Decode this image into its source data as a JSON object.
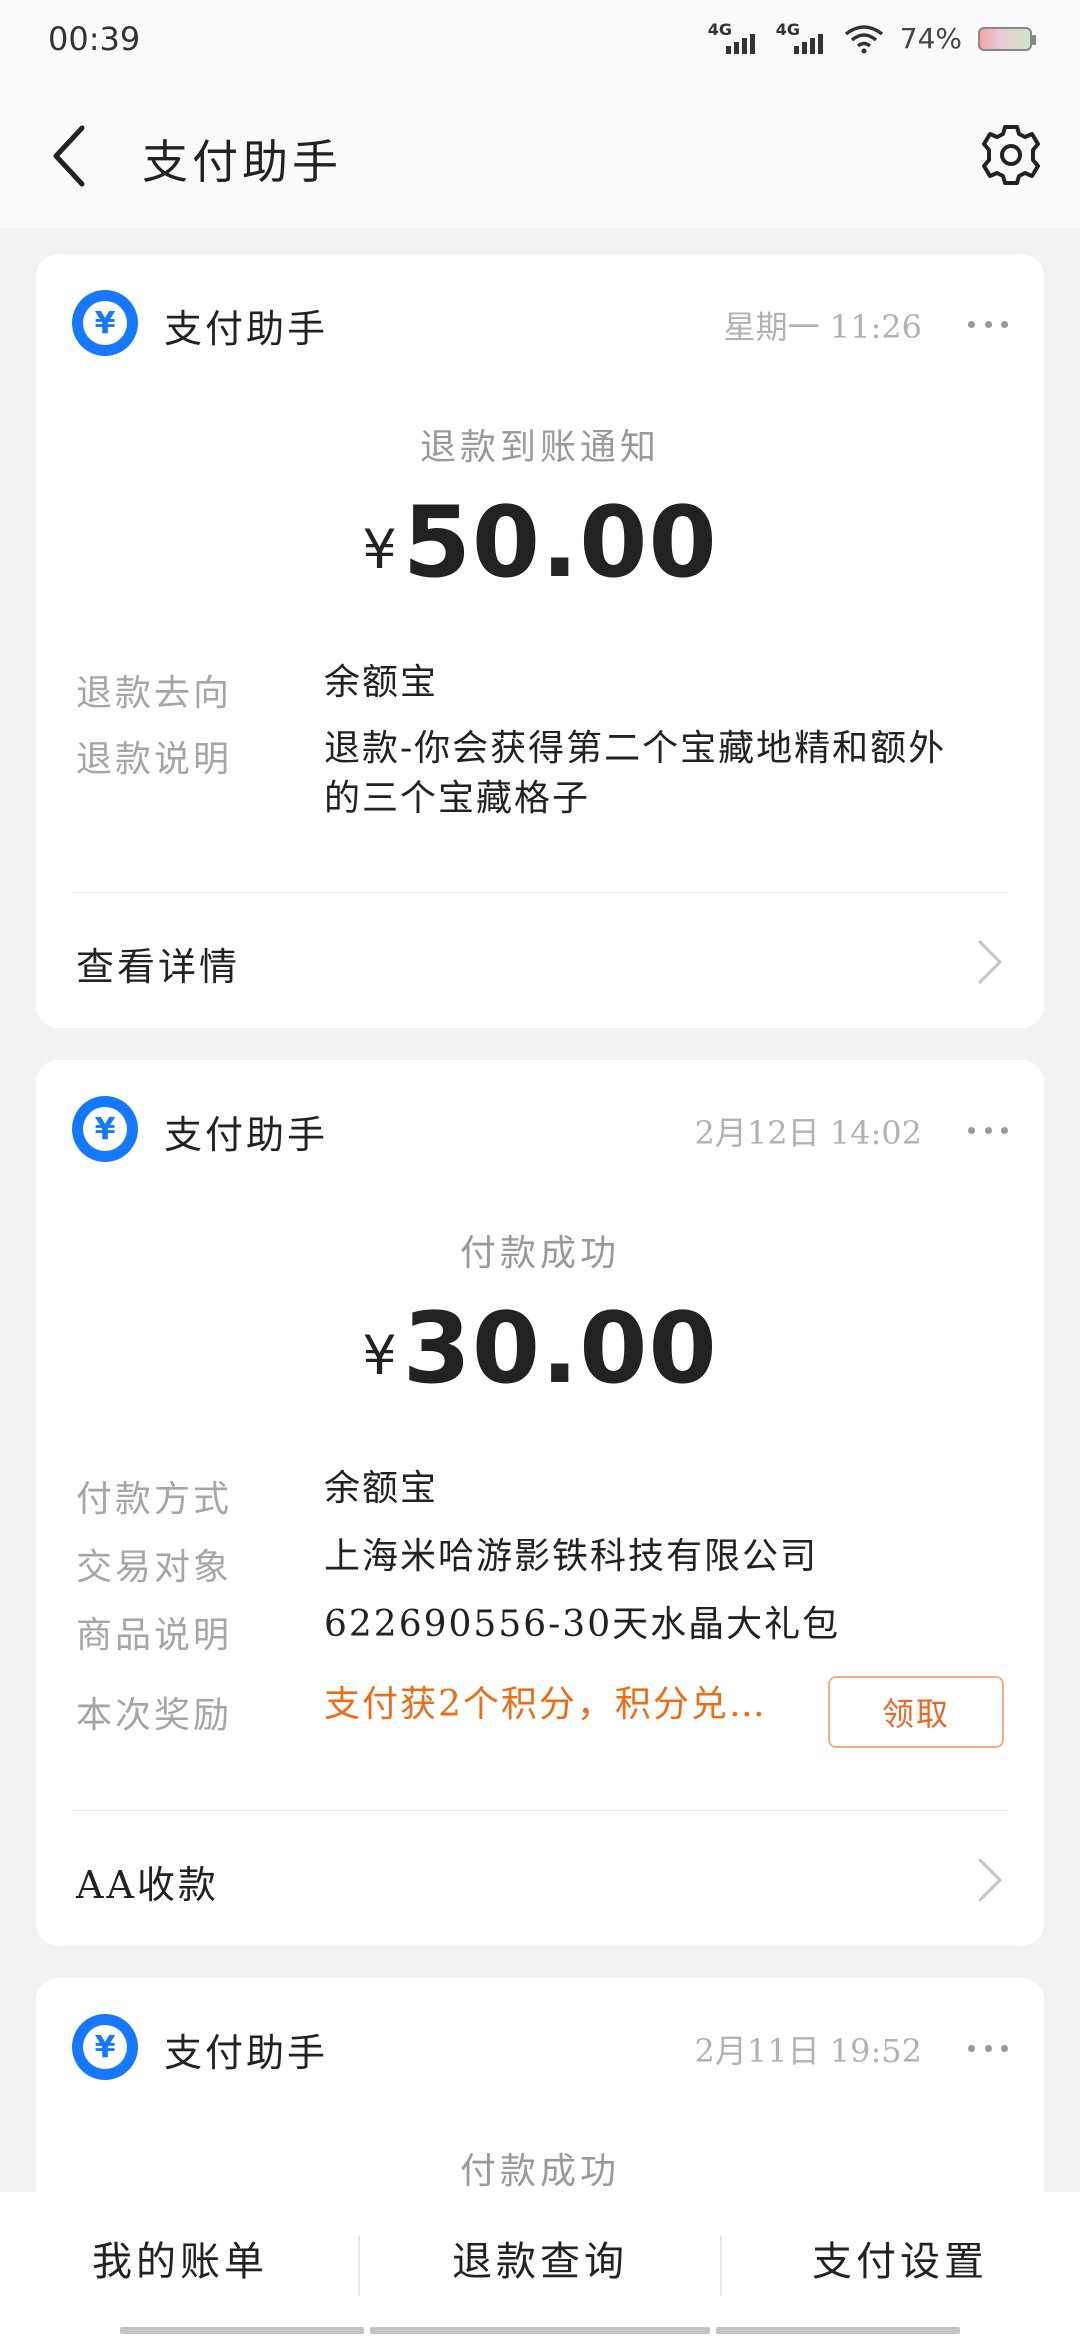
{
  "status_bar": {
    "time": "00:39",
    "network1": "4G",
    "network2": "4G",
    "battery": "74%"
  },
  "header": {
    "title": "支付助手"
  },
  "cards": [
    {
      "app_name": "支付助手",
      "time": "星期一 11:26",
      "notice_title": "退款到账通知",
      "currency": "¥",
      "amount": "50.00",
      "rows": [
        {
          "label": "退款去向",
          "value": "余额宝"
        },
        {
          "label": "退款说明",
          "value": "退款-你会获得第二个宝藏地精和额外的三个宝藏格子"
        }
      ],
      "link_label": "查看详情"
    },
    {
      "app_name": "支付助手",
      "time": "2月12日 14:02",
      "notice_title": "付款成功",
      "currency": "¥",
      "amount": "30.00",
      "rows": [
        {
          "label": "付款方式",
          "value": "余额宝"
        },
        {
          "label": "交易对象",
          "value": "上海米哈游影铁科技有限公司"
        },
        {
          "label": "商品说明",
          "value": "622690556-30天水晶大礼包"
        },
        {
          "label": "本次奖励",
          "value": "支付获2个积分，积分兑…"
        }
      ],
      "claim_button": "领取",
      "link_label": "AA收款"
    },
    {
      "app_name": "支付助手",
      "time": "2月11日 19:52",
      "notice_title": "付款成功"
    }
  ],
  "tabbar": {
    "tabs": [
      "我的账单",
      "退款查询",
      "支付设置"
    ]
  },
  "colors": {
    "accent": "#1677ff",
    "reward": "#ef6c17"
  }
}
